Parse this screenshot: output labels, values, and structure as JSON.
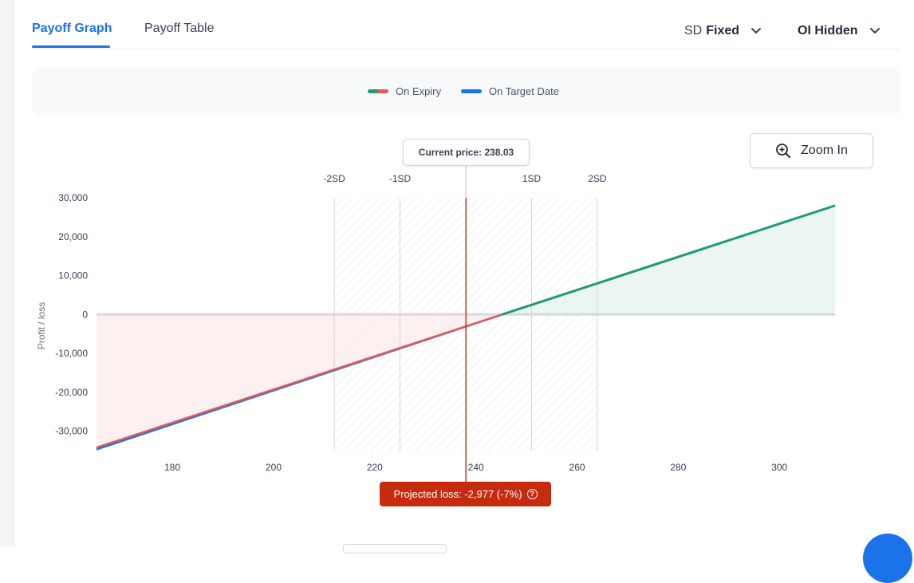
{
  "tabs": [
    {
      "label": "Payoff Graph",
      "active": true
    },
    {
      "label": "Payoff Table",
      "active": false
    }
  ],
  "dropdowns": {
    "sd": {
      "prefix": "SD",
      "value": "Fixed"
    },
    "oi": {
      "value": "OI Hidden"
    }
  },
  "legend": {
    "expiry": "On Expiry",
    "target": "On Target Date"
  },
  "zoom": {
    "label": "Zoom In"
  },
  "current_price_label": "Current price: 238.03",
  "projected_loss_label": "Projected loss: -2,977 (-7%)",
  "colors": {
    "accent": "#1a73e8",
    "profit": "#1e9e6a",
    "loss": "#e05a5a",
    "loss_badge": "#c62b0e"
  },
  "chart_data": {
    "type": "line",
    "ylabel": "Profit / loss",
    "xlabel": "",
    "xlim": [
      165,
      311
    ],
    "ylim": [
      -35000,
      30000
    ],
    "x_ticks": [
      180,
      200,
      220,
      240,
      260,
      280,
      300
    ],
    "y_ticks": [
      30000,
      20000,
      10000,
      0,
      -10000,
      -20000,
      -30000
    ],
    "y_tick_labels": [
      "30,000",
      "20,000",
      "10,000",
      "0",
      "-10,000",
      "-20,000",
      "-30,000"
    ],
    "sd_levels": [
      {
        "label": "-2SD",
        "x": 212
      },
      {
        "label": "-1SD",
        "x": 225
      },
      {
        "label": "1SD",
        "x": 251
      },
      {
        "label": "2SD",
        "x": 264
      }
    ],
    "current_price": 238.03,
    "series": [
      {
        "name": "On Expiry",
        "x": [
          165,
          245.2,
          311
        ],
        "y": [
          -34200,
          0,
          28000
        ]
      },
      {
        "name": "On Target Date",
        "x": [
          165,
          245.2,
          311
        ],
        "y": [
          -34700,
          0,
          28000
        ]
      }
    ]
  }
}
